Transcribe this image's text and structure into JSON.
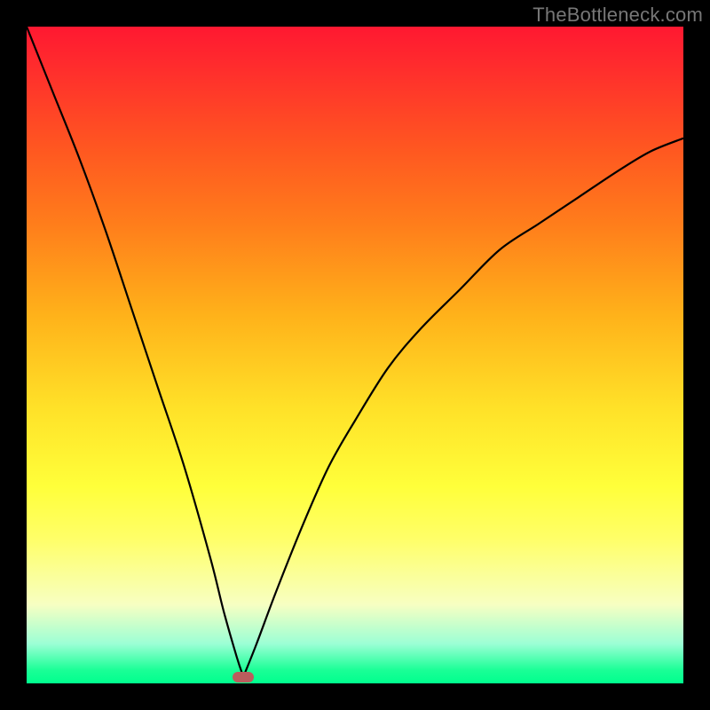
{
  "watermark": "TheBottleneck.com",
  "colors": {
    "curve": "#000000",
    "marker": "#bb5d5d",
    "frame": "#000000",
    "gradient_top": "#ff1831",
    "gradient_bottom": "#00ff8e"
  },
  "chart_data": {
    "type": "line",
    "title": "",
    "xlabel": "",
    "ylabel": "",
    "xlim": [
      0,
      100
    ],
    "ylim": [
      0,
      100
    ],
    "grid": false,
    "legend": false,
    "annotations": [
      {
        "type": "marker",
        "x": 33,
        "y": 1,
        "label": "optimal-point"
      }
    ],
    "series": [
      {
        "name": "left-branch",
        "x": [
          0,
          4,
          8,
          12,
          16,
          20,
          24,
          28,
          30,
          32,
          33
        ],
        "values": [
          100,
          90,
          80,
          69,
          57,
          45,
          33,
          19,
          11,
          4,
          1
        ]
      },
      {
        "name": "right-branch",
        "x": [
          33,
          35,
          38,
          42,
          46,
          50,
          55,
          60,
          66,
          72,
          78,
          84,
          90,
          95,
          100
        ],
        "values": [
          1,
          6,
          14,
          24,
          33,
          40,
          48,
          54,
          60,
          66,
          70,
          74,
          78,
          81,
          83
        ]
      }
    ]
  }
}
